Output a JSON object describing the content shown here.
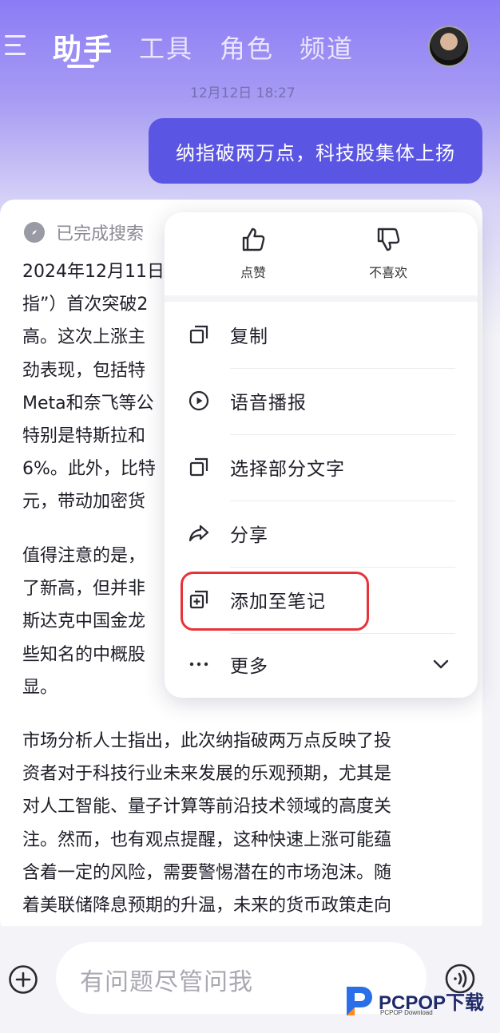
{
  "header": {
    "tabs": [
      {
        "label": "助手"
      },
      {
        "label": "工具"
      },
      {
        "label": "角色"
      },
      {
        "label": "频道"
      }
    ]
  },
  "chat": {
    "timestamp": "12月12日 18:27",
    "user_message": "纳指破两万点，科技股集体上扬",
    "search_status": "已完成搜索",
    "answer_lines_1": [
      "2024年12月11日",
      "指”）首次突破2",
      "高。这次上涨主",
      "劲表现，包括特",
      "Meta和奈飞等公",
      "特别是特斯拉和",
      "6%。此外，比特",
      "元，带动加密货"
    ],
    "answer_lines_2": [
      "值得注意的是，",
      "了新高，但并非",
      "斯达克中国金龙",
      "些知名的中概股",
      "显。"
    ],
    "answer_lines_3": [
      "市场分析人士指出，此次纳指破两万点反映了投",
      "资者对于科技行业未来发展的乐观预期，尤其是",
      "对人工智能、量子计算等前沿技术领域的高度关",
      "注。然而，也有观点提醒，这种快速上涨可能蕴",
      "含着一定的风险，需要警惕潜在的市场泡沫。随",
      "着美联储降息预期的升温，未来的货币政策走向"
    ]
  },
  "popup": {
    "like_label": "点赞",
    "dislike_label": "不喜欢",
    "items": [
      {
        "label": "复制",
        "icon": "copy-icon"
      },
      {
        "label": "语音播报",
        "icon": "play-circle-icon"
      },
      {
        "label": "选择部分文字",
        "icon": "select-text-icon"
      },
      {
        "label": "分享",
        "icon": "share-icon"
      },
      {
        "label": "添加至笔记",
        "icon": "add-note-icon"
      },
      {
        "label": "更多",
        "icon": "more-icon"
      }
    ]
  },
  "input": {
    "placeholder": "有问题尽管问我"
  },
  "watermark": {
    "brand": "PCPOP",
    "brand_cn": "下载",
    "sub": "PCPOP Download"
  },
  "colors": {
    "accent": "#5b55e4",
    "highlight": "#e8323a"
  }
}
